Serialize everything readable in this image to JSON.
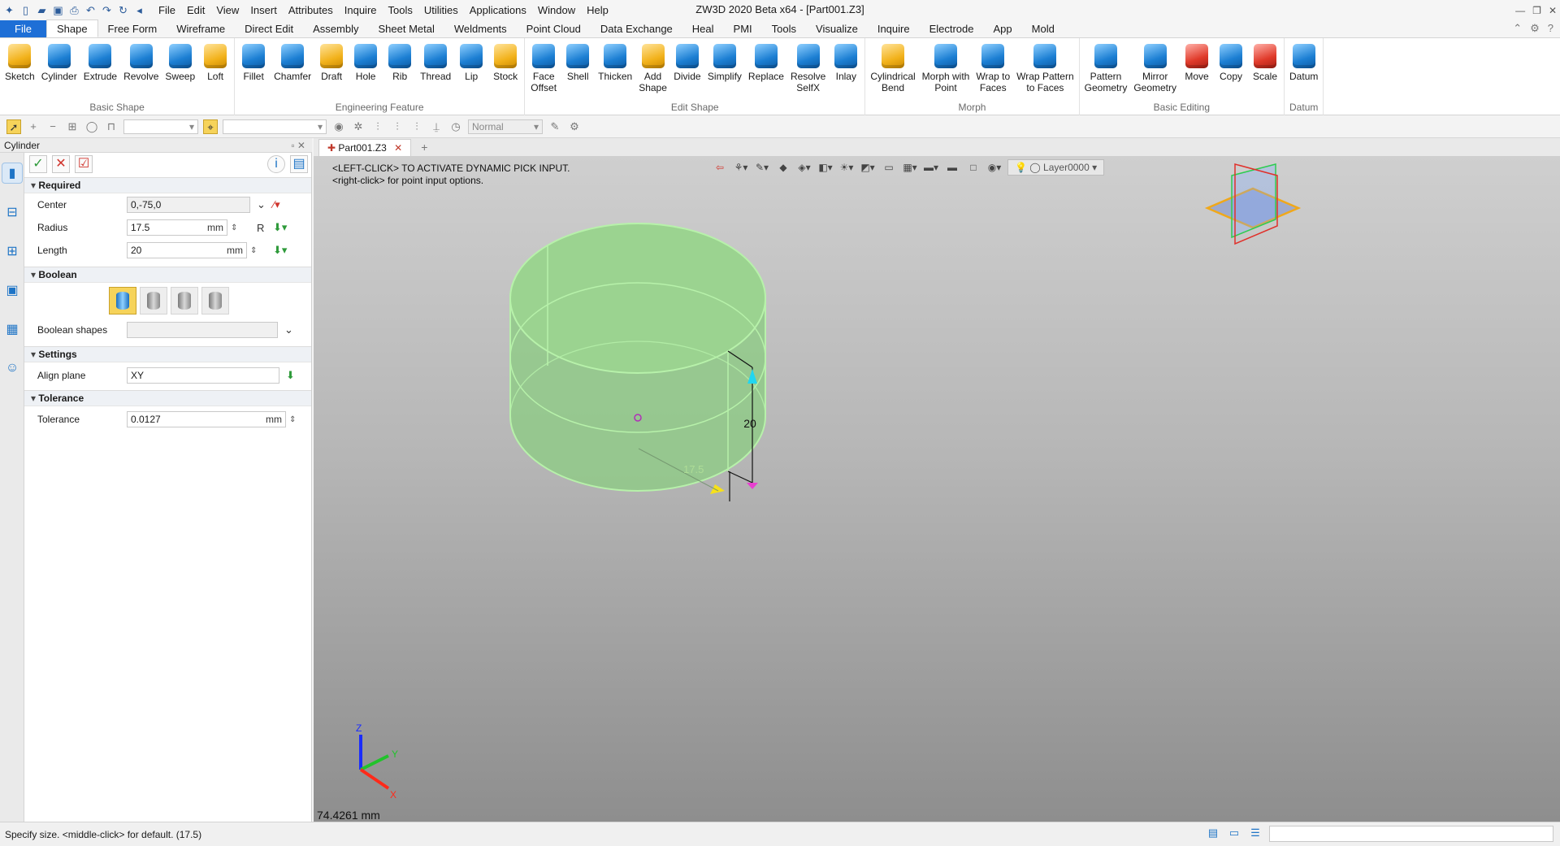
{
  "app": {
    "title": "ZW3D 2020 Beta x64 - [Part001.Z3]",
    "menu": [
      "File",
      "Edit",
      "View",
      "Insert",
      "Attributes",
      "Inquire",
      "Tools",
      "Utilities",
      "Applications",
      "Window",
      "Help"
    ]
  },
  "ribbon_tabs": [
    "File",
    "Shape",
    "Free Form",
    "Wireframe",
    "Direct Edit",
    "Assembly",
    "Sheet Metal",
    "Weldments",
    "Point Cloud",
    "Data Exchange",
    "Heal",
    "PMI",
    "Tools",
    "Visualize",
    "Inquire",
    "Electrode",
    "App",
    "Mold"
  ],
  "active_tab": "Shape",
  "ribbon_groups": [
    {
      "label": "Basic Shape",
      "tools": [
        "Sketch",
        "Cylinder",
        "Extrude",
        "Revolve",
        "Sweep",
        "Loft"
      ]
    },
    {
      "label": "Engineering Feature",
      "tools": [
        "Fillet",
        "Chamfer",
        "Draft",
        "Hole",
        "Rib",
        "Thread",
        "Lip",
        "Stock"
      ]
    },
    {
      "label": "Edit Shape",
      "tools": [
        "Face\nOffset",
        "Shell",
        "Thicken",
        "Add\nShape",
        "Divide",
        "Simplify",
        "Replace",
        "Resolve\nSelfX",
        "Inlay"
      ]
    },
    {
      "label": "Morph",
      "tools": [
        "Cylindrical\nBend",
        "Morph with\nPoint",
        "Wrap to\nFaces",
        "Wrap Pattern\nto Faces"
      ]
    },
    {
      "label": "Basic Editing",
      "tools": [
        "Pattern\nGeometry",
        "Mirror\nGeometry",
        "Move",
        "Copy",
        "Scale"
      ]
    },
    {
      "label": "Datum",
      "tools": [
        "Datum"
      ]
    }
  ],
  "toolbar2": {
    "render_mode": "Normal"
  },
  "panel": {
    "title": "Cylinder",
    "sections": {
      "required": "Required",
      "boolean": "Boolean",
      "settings": "Settings",
      "tolerance": "Tolerance"
    },
    "center": {
      "label": "Center",
      "value": "0,-75,0"
    },
    "radius": {
      "label": "Radius",
      "value": "17.5",
      "unit": "mm"
    },
    "length": {
      "label": "Length",
      "value": "20",
      "unit": "mm"
    },
    "boolean_shapes": {
      "label": "Boolean shapes",
      "value": ""
    },
    "align_plane": {
      "label": "Align plane",
      "value": "XY"
    },
    "tolerance": {
      "label": "Tolerance",
      "value": "0.0127",
      "unit": "mm"
    }
  },
  "document_tab": "Part001.Z3",
  "viewport": {
    "hint_line1": "<LEFT-CLICK> TO ACTIVATE DYNAMIC PICK INPUT.",
    "hint_line2": "<right-click> for point input options.",
    "layer": "Layer0000",
    "length_label": "20",
    "radius_label": "17.5",
    "distance_readout": "74.4261 mm",
    "axis_x": "X",
    "axis_y": "Y",
    "axis_z": "Z"
  },
  "status": {
    "text": "Specify size.  <middle-click> for default. (17.5)"
  }
}
